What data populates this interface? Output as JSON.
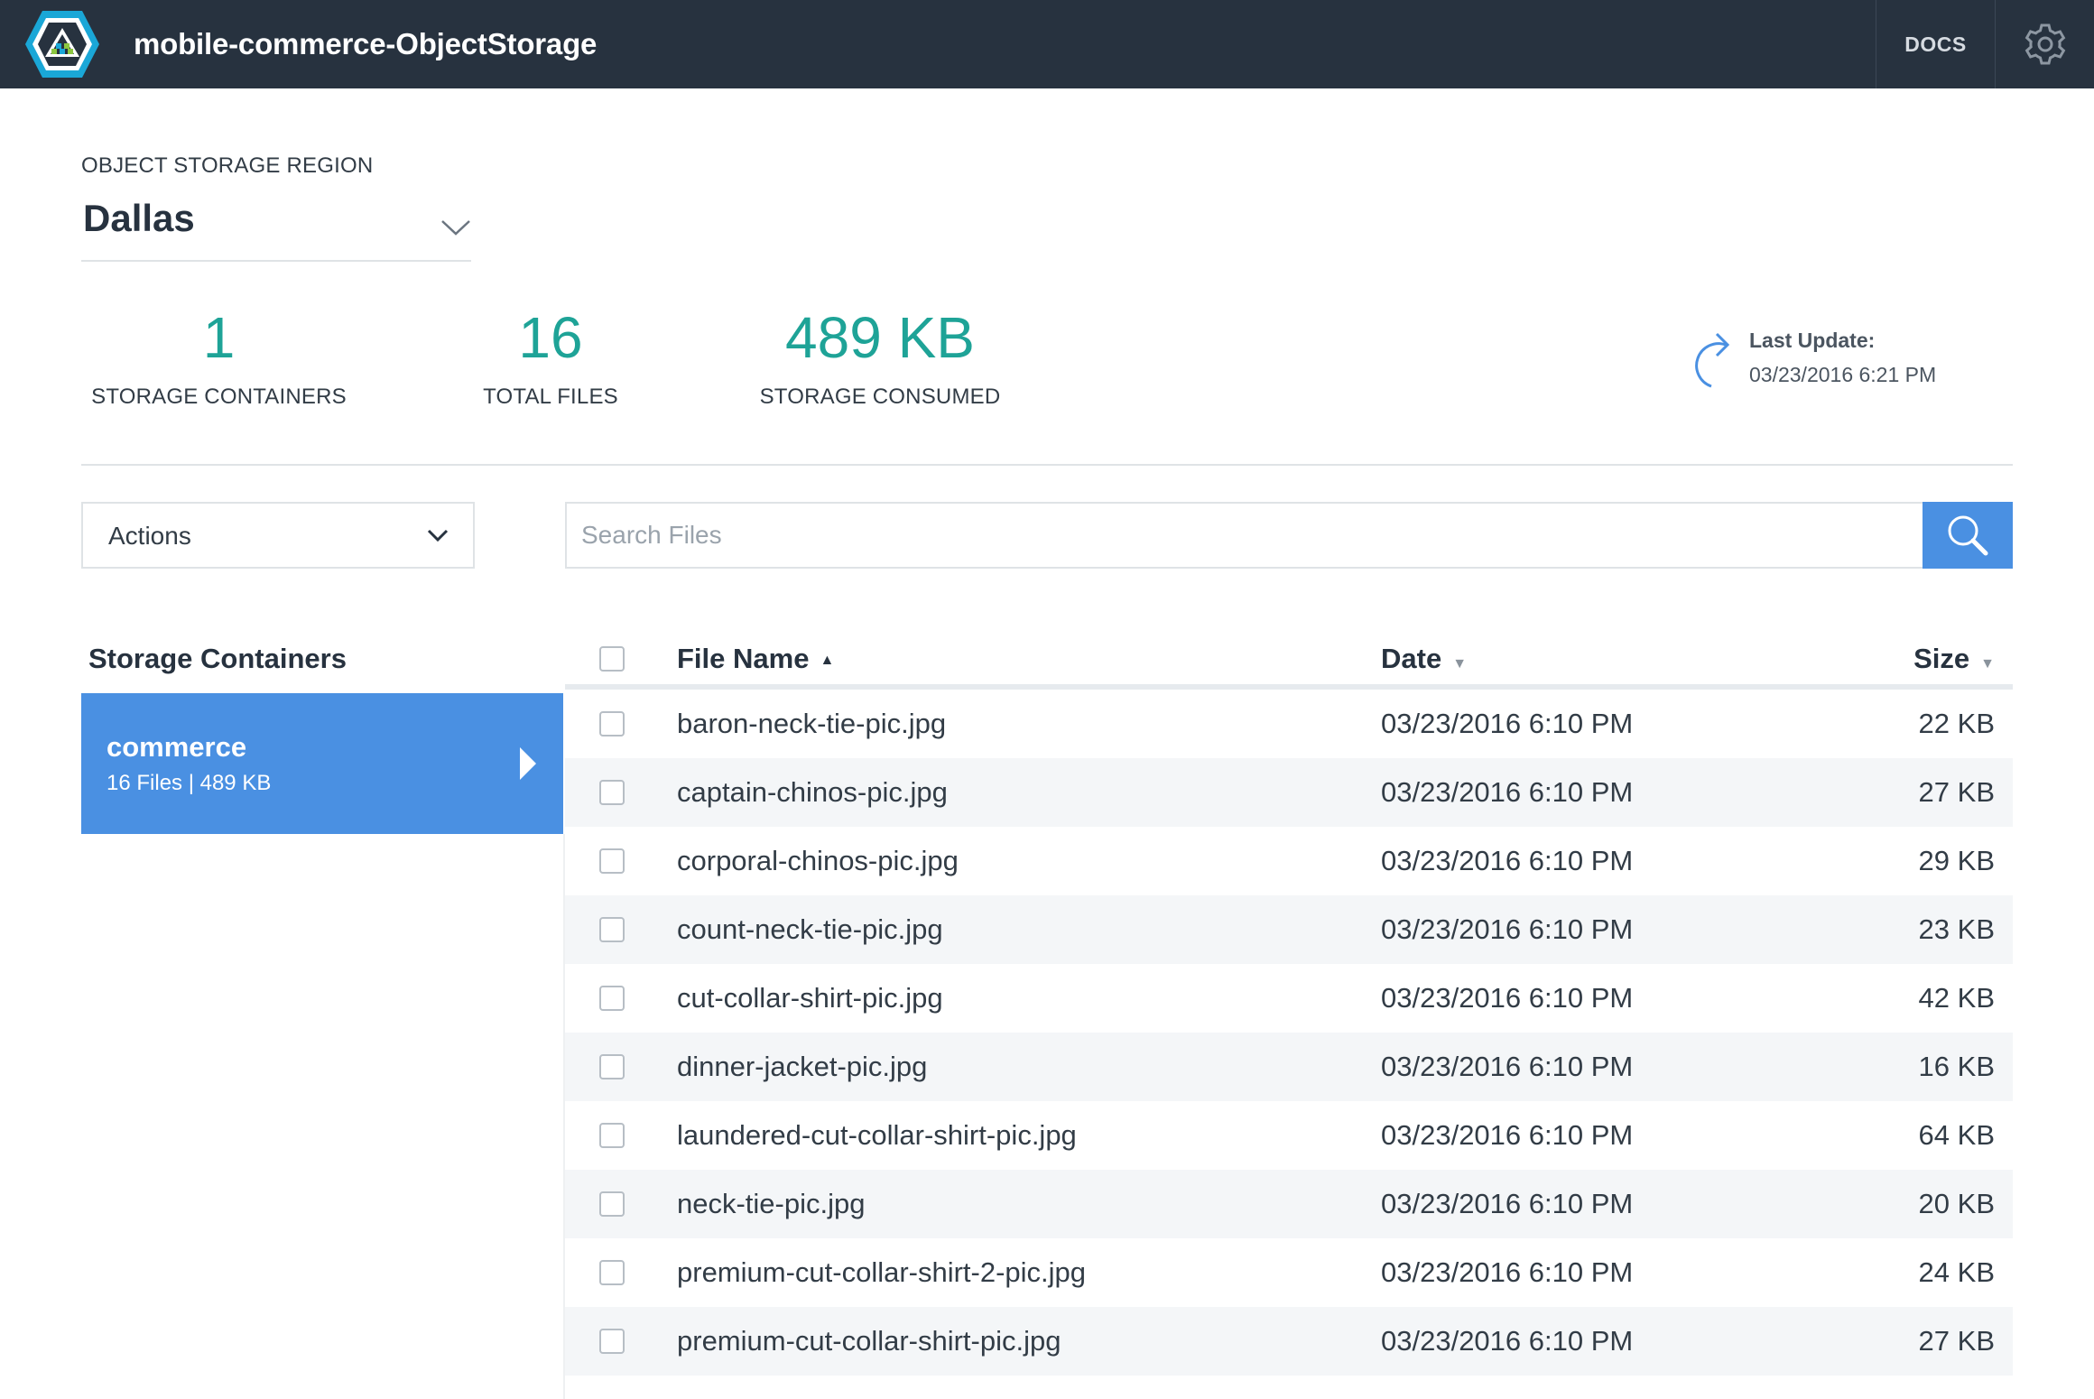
{
  "app": {
    "title": "mobile-commerce-ObjectStorage",
    "docs_label": "DOCS",
    "accent": "#4a90e2",
    "teal": "#1ea397",
    "topbar_bg": "#27323f"
  },
  "region": {
    "label": "OBJECT STORAGE REGION",
    "value": "Dallas"
  },
  "stats": [
    {
      "value": "1",
      "label": "STORAGE CONTAINERS"
    },
    {
      "value": "16",
      "label": "TOTAL FILES"
    },
    {
      "value": "489 KB",
      "label": "STORAGE CONSUMED"
    }
  ],
  "last_update": {
    "label": "Last Update:",
    "value": "03/23/2016 6:21 PM"
  },
  "toolbar": {
    "actions_label": "Actions",
    "search_placeholder": "Search Files"
  },
  "containers": {
    "title": "Storage Containers",
    "items": [
      {
        "name": "commerce",
        "meta": "16 Files | 489 KB"
      }
    ]
  },
  "table": {
    "columns": {
      "name": "File Name",
      "date": "Date",
      "size": "Size"
    },
    "rows": [
      {
        "name": "baron-neck-tie-pic.jpg",
        "date": "03/23/2016 6:10 PM",
        "size": "22 KB"
      },
      {
        "name": "captain-chinos-pic.jpg",
        "date": "03/23/2016 6:10 PM",
        "size": "27 KB"
      },
      {
        "name": "corporal-chinos-pic.jpg",
        "date": "03/23/2016 6:10 PM",
        "size": "29 KB"
      },
      {
        "name": "count-neck-tie-pic.jpg",
        "date": "03/23/2016 6:10 PM",
        "size": "23 KB"
      },
      {
        "name": "cut-collar-shirt-pic.jpg",
        "date": "03/23/2016 6:10 PM",
        "size": "42 KB"
      },
      {
        "name": "dinner-jacket-pic.jpg",
        "date": "03/23/2016 6:10 PM",
        "size": "16 KB"
      },
      {
        "name": "laundered-cut-collar-shirt-pic.jpg",
        "date": "03/23/2016 6:10 PM",
        "size": "64 KB"
      },
      {
        "name": "neck-tie-pic.jpg",
        "date": "03/23/2016 6:10 PM",
        "size": "20 KB"
      },
      {
        "name": "premium-cut-collar-shirt-2-pic.jpg",
        "date": "03/23/2016 6:10 PM",
        "size": "24 KB"
      },
      {
        "name": "premium-cut-collar-shirt-pic.jpg",
        "date": "03/23/2016 6:10 PM",
        "size": "27 KB"
      }
    ]
  }
}
